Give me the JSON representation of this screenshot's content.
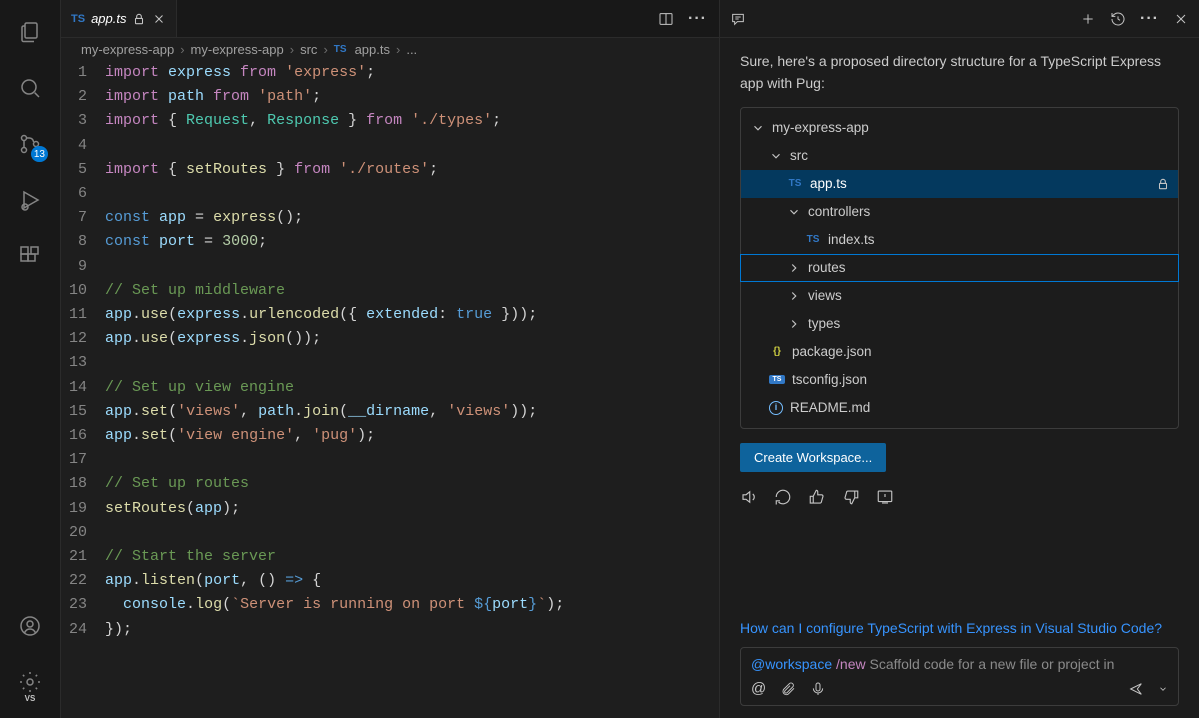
{
  "tab": {
    "filename": "app.ts"
  },
  "breadcrumbs": {
    "parts": [
      "my-express-app",
      "my-express-app",
      "src"
    ],
    "file": "app.ts",
    "tail": "..."
  },
  "code": {
    "lines": [
      {
        "n": 1,
        "tokens": [
          [
            "k",
            "import "
          ],
          [
            "v",
            "express"
          ],
          [
            "k",
            " from "
          ],
          [
            "s",
            "'express'"
          ],
          [
            "p",
            ";"
          ]
        ]
      },
      {
        "n": 2,
        "tokens": [
          [
            "k",
            "import "
          ],
          [
            "v",
            "path"
          ],
          [
            "k",
            " from "
          ],
          [
            "s",
            "'path'"
          ],
          [
            "p",
            ";"
          ]
        ]
      },
      {
        "n": 3,
        "tokens": [
          [
            "k",
            "import "
          ],
          [
            "p",
            "{ "
          ],
          [
            "t",
            "Request"
          ],
          [
            "p",
            ", "
          ],
          [
            "t",
            "Response"
          ],
          [
            "p",
            " } "
          ],
          [
            "k",
            "from "
          ],
          [
            "s",
            "'./types'"
          ],
          [
            "p",
            ";"
          ]
        ]
      },
      {
        "n": 4,
        "tokens": []
      },
      {
        "n": 5,
        "tokens": [
          [
            "k",
            "import "
          ],
          [
            "p",
            "{ "
          ],
          [
            "f",
            "setRoutes"
          ],
          [
            "p",
            " } "
          ],
          [
            "k",
            "from "
          ],
          [
            "s",
            "'./routes'"
          ],
          [
            "p",
            ";"
          ]
        ]
      },
      {
        "n": 6,
        "tokens": []
      },
      {
        "n": 7,
        "tokens": [
          [
            "b",
            "const "
          ],
          [
            "v",
            "app"
          ],
          [
            "p",
            " = "
          ],
          [
            "f",
            "express"
          ],
          [
            "p",
            "();"
          ]
        ]
      },
      {
        "n": 8,
        "tokens": [
          [
            "b",
            "const "
          ],
          [
            "v",
            "port"
          ],
          [
            "p",
            " = "
          ],
          [
            "n",
            "3000"
          ],
          [
            "p",
            ";"
          ]
        ]
      },
      {
        "n": 9,
        "tokens": []
      },
      {
        "n": 10,
        "tokens": [
          [
            "c",
            "// Set up middleware"
          ]
        ]
      },
      {
        "n": 11,
        "tokens": [
          [
            "v",
            "app"
          ],
          [
            "p",
            "."
          ],
          [
            "f",
            "use"
          ],
          [
            "p",
            "("
          ],
          [
            "v",
            "express"
          ],
          [
            "p",
            "."
          ],
          [
            "f",
            "urlencoded"
          ],
          [
            "p",
            "({ "
          ],
          [
            "v",
            "extended"
          ],
          [
            "p",
            ": "
          ],
          [
            "b",
            "true"
          ],
          [
            "p",
            " }));"
          ]
        ]
      },
      {
        "n": 12,
        "tokens": [
          [
            "v",
            "app"
          ],
          [
            "p",
            "."
          ],
          [
            "f",
            "use"
          ],
          [
            "p",
            "("
          ],
          [
            "v",
            "express"
          ],
          [
            "p",
            "."
          ],
          [
            "f",
            "json"
          ],
          [
            "p",
            "());"
          ]
        ]
      },
      {
        "n": 13,
        "tokens": []
      },
      {
        "n": 14,
        "tokens": [
          [
            "c",
            "// Set up view engine"
          ]
        ]
      },
      {
        "n": 15,
        "tokens": [
          [
            "v",
            "app"
          ],
          [
            "p",
            "."
          ],
          [
            "f",
            "set"
          ],
          [
            "p",
            "("
          ],
          [
            "s",
            "'views'"
          ],
          [
            "p",
            ", "
          ],
          [
            "v",
            "path"
          ],
          [
            "p",
            "."
          ],
          [
            "f",
            "join"
          ],
          [
            "p",
            "("
          ],
          [
            "v",
            "__dirname"
          ],
          [
            "p",
            ", "
          ],
          [
            "s",
            "'views'"
          ],
          [
            "p",
            "));"
          ]
        ]
      },
      {
        "n": 16,
        "tokens": [
          [
            "v",
            "app"
          ],
          [
            "p",
            "."
          ],
          [
            "f",
            "set"
          ],
          [
            "p",
            "("
          ],
          [
            "s",
            "'view engine'"
          ],
          [
            "p",
            ", "
          ],
          [
            "s",
            "'pug'"
          ],
          [
            "p",
            ");"
          ]
        ]
      },
      {
        "n": 17,
        "tokens": []
      },
      {
        "n": 18,
        "tokens": [
          [
            "c",
            "// Set up routes"
          ]
        ]
      },
      {
        "n": 19,
        "tokens": [
          [
            "f",
            "setRoutes"
          ],
          [
            "p",
            "("
          ],
          [
            "v",
            "app"
          ],
          [
            "p",
            ");"
          ]
        ]
      },
      {
        "n": 20,
        "tokens": []
      },
      {
        "n": 21,
        "tokens": [
          [
            "c",
            "// Start the server"
          ]
        ]
      },
      {
        "n": 22,
        "tokens": [
          [
            "v",
            "app"
          ],
          [
            "p",
            "."
          ],
          [
            "f",
            "listen"
          ],
          [
            "p",
            "("
          ],
          [
            "v",
            "port"
          ],
          [
            "p",
            ", () "
          ],
          [
            "b",
            "=>"
          ],
          [
            "p",
            " {"
          ]
        ]
      },
      {
        "n": 23,
        "tokens": [
          [
            "p",
            "  "
          ],
          [
            "v",
            "console"
          ],
          [
            "p",
            "."
          ],
          [
            "f",
            "log"
          ],
          [
            "p",
            "("
          ],
          [
            "s",
            "`Server is running on port "
          ],
          [
            "b",
            "${"
          ],
          [
            "v",
            "port"
          ],
          [
            "b",
            "}"
          ],
          [
            "s",
            "`"
          ],
          [
            "p",
            ");"
          ]
        ]
      },
      {
        "n": 24,
        "tokens": [
          [
            "p",
            "});"
          ]
        ]
      }
    ]
  },
  "activity": {
    "scm_badge": "13"
  },
  "chat": {
    "message": "Sure, here's a proposed directory structure for a TypeScript Express app with Pug:",
    "tree": [
      {
        "depth": 0,
        "kind": "folder",
        "open": true,
        "label": "my-express-app"
      },
      {
        "depth": 1,
        "kind": "folder",
        "open": true,
        "label": "src"
      },
      {
        "depth": 2,
        "kind": "ts",
        "label": "app.ts",
        "selected": true,
        "locked": true
      },
      {
        "depth": 2,
        "kind": "folder",
        "open": true,
        "label": "controllers"
      },
      {
        "depth": 3,
        "kind": "ts",
        "label": "index.ts"
      },
      {
        "depth": 2,
        "kind": "folder",
        "open": false,
        "label": "routes",
        "hl": true
      },
      {
        "depth": 2,
        "kind": "folder",
        "open": false,
        "label": "views"
      },
      {
        "depth": 2,
        "kind": "folder",
        "open": false,
        "label": "types"
      },
      {
        "depth": 1,
        "kind": "json",
        "label": "package.json"
      },
      {
        "depth": 1,
        "kind": "tsconf",
        "label": "tsconfig.json"
      },
      {
        "depth": 1,
        "kind": "info",
        "label": "README.md"
      }
    ],
    "primary_button": "Create Workspace...",
    "followup": "How can I configure TypeScript with Express in Visual Studio Code?",
    "input": {
      "agent": "@workspace",
      "slash": "/new",
      "rest": " Scaffold code for a new file or project in"
    }
  }
}
